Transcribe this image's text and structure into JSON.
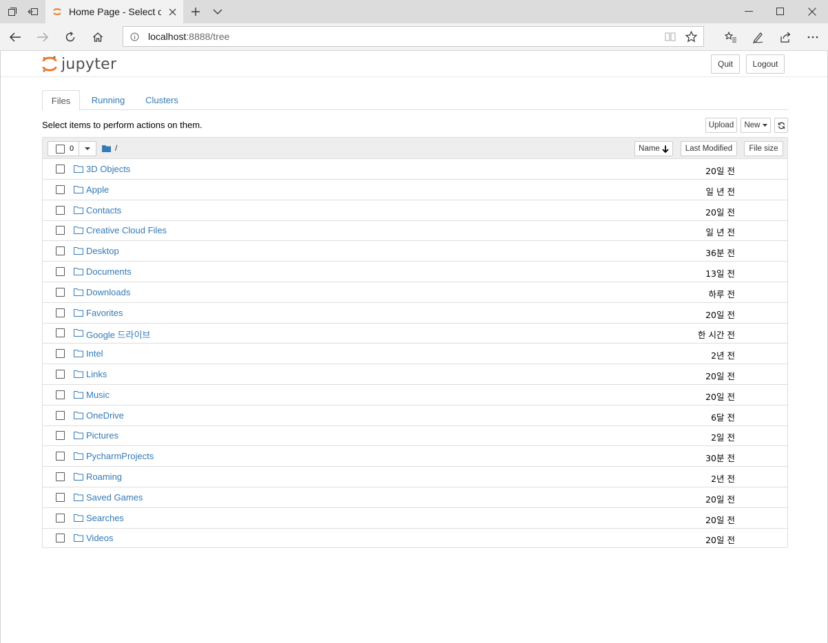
{
  "browser": {
    "tab_title": "Home Page - Select or create a notebook",
    "address": {
      "host": "localhost",
      "rest": ":8888/tree"
    }
  },
  "app": {
    "logo_text": "jupyter",
    "quit_label": "Quit",
    "logout_label": "Logout",
    "tabs": [
      {
        "label": "Files",
        "active": true
      },
      {
        "label": "Running",
        "active": false
      },
      {
        "label": "Clusters",
        "active": false
      }
    ],
    "hint": "Select items to perform actions on them.",
    "upload_label": "Upload",
    "new_label": "New",
    "list_header": {
      "selected_count": "0",
      "path": "/",
      "name_col": "Name",
      "last_modified_col": "Last Modified",
      "file_size_col": "File size"
    },
    "items": [
      {
        "name": "3D Objects",
        "modified": "20일 전"
      },
      {
        "name": "Apple",
        "modified": "일 년 전"
      },
      {
        "name": "Contacts",
        "modified": "20일 전"
      },
      {
        "name": "Creative Cloud Files",
        "modified": "일 년 전"
      },
      {
        "name": "Desktop",
        "modified": "36분 전"
      },
      {
        "name": "Documents",
        "modified": "13일 전"
      },
      {
        "name": "Downloads",
        "modified": "하루 전"
      },
      {
        "name": "Favorites",
        "modified": "20일 전"
      },
      {
        "name": "Google 드라이브",
        "modified": "한 시간 전"
      },
      {
        "name": "Intel",
        "modified": "2년 전"
      },
      {
        "name": "Links",
        "modified": "20일 전"
      },
      {
        "name": "Music",
        "modified": "20일 전"
      },
      {
        "name": "OneDrive",
        "modified": "6달 전"
      },
      {
        "name": "Pictures",
        "modified": "2일 전"
      },
      {
        "name": "PycharmProjects",
        "modified": "30분 전"
      },
      {
        "name": "Roaming",
        "modified": "2년 전"
      },
      {
        "name": "Saved Games",
        "modified": "20일 전"
      },
      {
        "name": "Searches",
        "modified": "20일 전"
      },
      {
        "name": "Videos",
        "modified": "20일 전"
      }
    ]
  },
  "colors": {
    "link": "#337ab7",
    "jupyter_orange": "#f37726",
    "folder_icon": "#337ab7"
  }
}
